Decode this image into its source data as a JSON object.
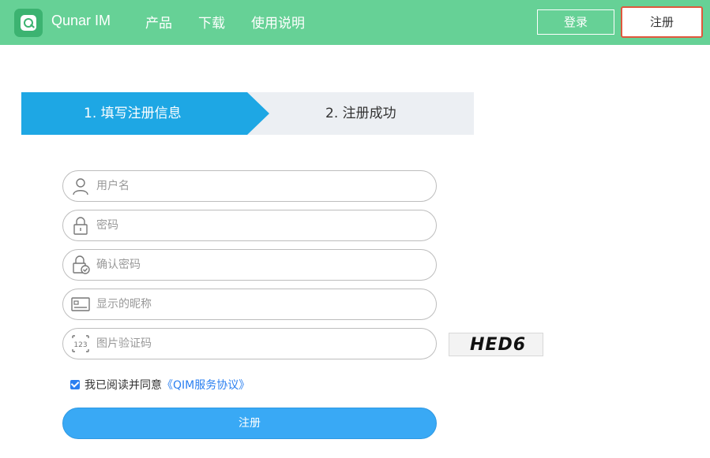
{
  "header": {
    "brand": "Qunar IM",
    "nav": [
      {
        "label": "产品"
      },
      {
        "label": "下载"
      },
      {
        "label": "使用说明"
      }
    ],
    "login_label": "登录",
    "register_label": "注册"
  },
  "steps": [
    {
      "label": "1. 填写注册信息",
      "active": true
    },
    {
      "label": "2. 注册成功",
      "active": false
    }
  ],
  "form": {
    "username_placeholder": "用户名",
    "password_placeholder": "密码",
    "confirm_placeholder": "确认密码",
    "nickname_placeholder": "显示的昵称",
    "captcha_placeholder": "图片验证码",
    "captcha_text": "HED6",
    "agree_text": "我已阅读并同意",
    "agree_link": "《QIM服务协议》",
    "agree_checked": true,
    "submit_label": "注册"
  },
  "colors": {
    "header_bg": "#66d196",
    "step_active": "#1ea7e4",
    "step_inactive": "#eceff3",
    "submit_bg": "#39a9f5",
    "link": "#2a7ff0",
    "highlight_border": "#e0573d"
  }
}
